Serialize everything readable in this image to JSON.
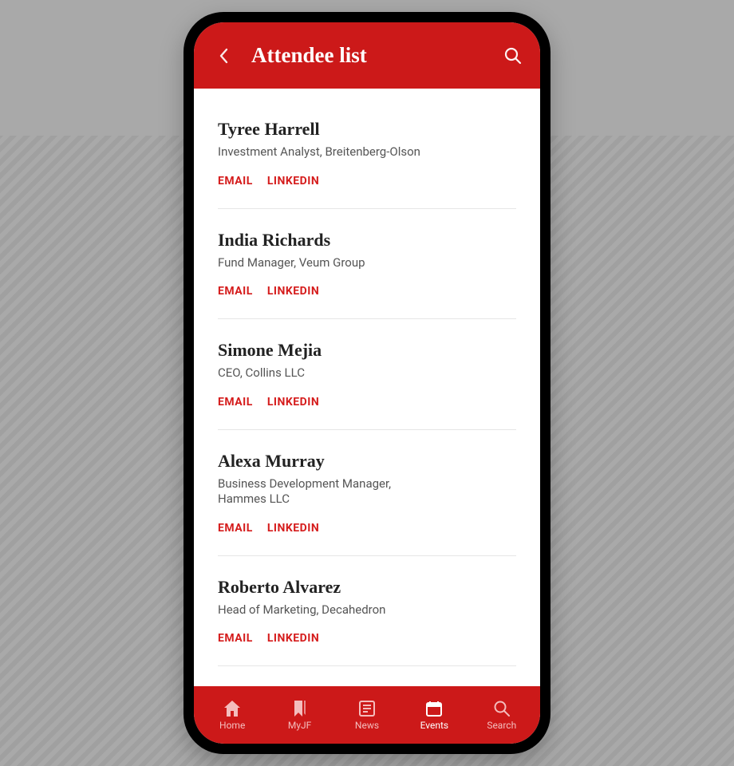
{
  "header": {
    "title": "Attendee list"
  },
  "attendees": [
    {
      "name": "Tyree Harrell",
      "role": "Investment Analyst, Breitenberg-Olson",
      "email_label": "EMAIL",
      "linkedin_label": "LINKEDIN"
    },
    {
      "name": "India Richards",
      "role": "Fund Manager, Veum Group",
      "email_label": "EMAIL",
      "linkedin_label": "LINKEDIN"
    },
    {
      "name": "Simone Mejia",
      "role": "CEO, Collins LLC",
      "email_label": "EMAIL",
      "linkedin_label": "LINKEDIN"
    },
    {
      "name": "Alexa Murray",
      "role": "Business Development Manager, Hammes LLC",
      "email_label": "EMAIL",
      "linkedin_label": "LINKEDIN"
    },
    {
      "name": "Roberto Alvarez",
      "role": "Head of Marketing, Decahedron",
      "email_label": "EMAIL",
      "linkedin_label": "LINKEDIN"
    }
  ],
  "nav": {
    "home": "Home",
    "myjf": "MyJF",
    "news": "News",
    "events": "Events",
    "search": "Search",
    "active": "events"
  },
  "colors": {
    "brand_red": "#cc1919",
    "link_red": "#d51c1c"
  }
}
